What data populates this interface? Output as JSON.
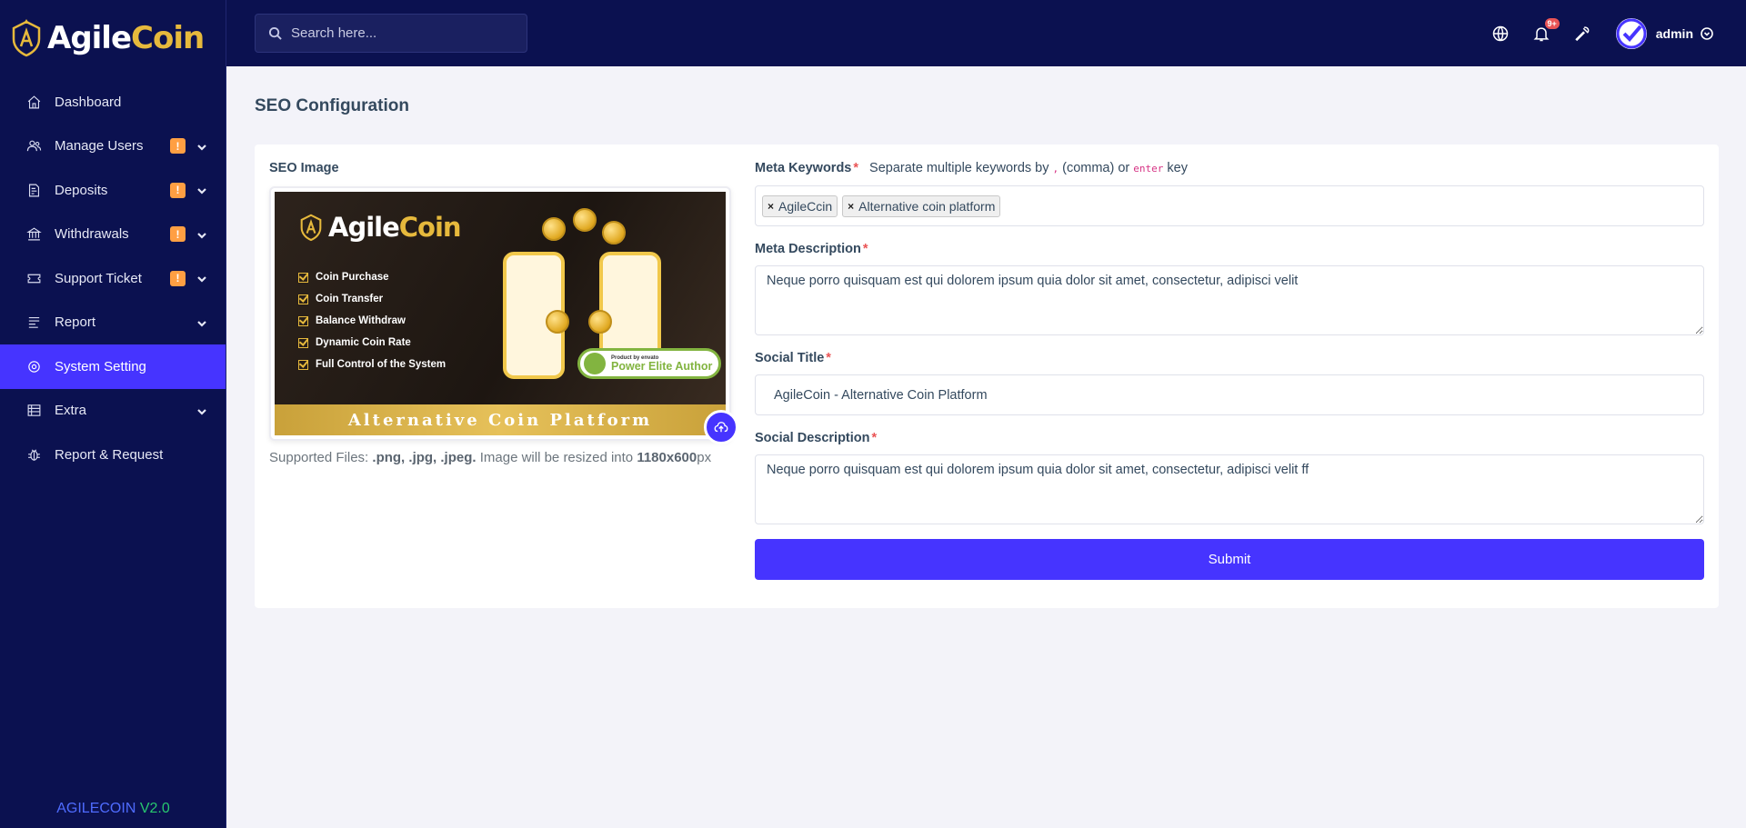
{
  "brand": {
    "name_part1": "Agile",
    "name_part2": "Coin"
  },
  "sidebar": {
    "items": [
      {
        "label": "Dashboard",
        "badge": "",
        "icon": "home-icon"
      },
      {
        "label": "Manage Users",
        "badge": "!",
        "icon": "users-icon"
      },
      {
        "label": "Deposits",
        "badge": "!",
        "icon": "deposit-icon"
      },
      {
        "label": "Withdrawals",
        "badge": "!",
        "icon": "bank-icon"
      },
      {
        "label": "Support Ticket",
        "badge": "!",
        "icon": "ticket-icon"
      },
      {
        "label": "Report",
        "badge": "",
        "icon": "list-icon"
      },
      {
        "label": "System Setting",
        "badge": "",
        "icon": "settings-icon"
      },
      {
        "label": "Extra",
        "badge": "",
        "icon": "server-icon"
      },
      {
        "label": "Report & Request",
        "badge": "",
        "icon": "bug-icon"
      }
    ],
    "version_name": "AGILECOIN",
    "version_number": "V2.0"
  },
  "topbar": {
    "search_placeholder": "Search here...",
    "notification_count": "9+",
    "username": "admin"
  },
  "page": {
    "title": "SEO Configuration",
    "seo_image_label": "SEO Image",
    "banner": {
      "title_part1": "Agile",
      "title_part2": "Coin",
      "features": [
        "Coin Purchase",
        "Coin Transfer",
        "Balance Withdraw",
        "Dynamic Coin Rate",
        "Full Control of the System"
      ],
      "badge_small": "Product by envato",
      "badge_big": "Power Elite Author",
      "strip_text": "Alternative Coin Platform"
    },
    "supported_prefix": "Supported Files:",
    "supported_types": ".png, .jpg, .jpeg.",
    "supported_mid": "Image will be resized into",
    "supported_size": "1180x600",
    "supported_unit": "px",
    "meta_keywords_label": "Meta Keywords",
    "meta_keywords_hint_1": "Separate multiple keywords by",
    "meta_keywords_hint_code1": ",",
    "meta_keywords_hint_2": "(comma) or",
    "meta_keywords_hint_code2": "enter",
    "meta_keywords_hint_3": "key",
    "keywords": [
      "AgileCcin",
      "Alternative coin platform"
    ],
    "meta_description_label": "Meta Description",
    "meta_description_value": "Neque porro quisquam est qui dolorem ipsum quia dolor sit amet, consectetur, adipisci velit",
    "social_title_label": "Social Title",
    "social_title_value": "AgileCoin - Alternative Coin Platform",
    "social_description_label": "Social Description",
    "social_description_value": "Neque porro quisquam est qui dolorem ipsum quia dolor sit amet, consectetur, adipisci velit ff",
    "submit_label": "Submit",
    "required_mark": "*"
  },
  "colors": {
    "sidebar_bg": "#0b1150",
    "accent": "#4634ff",
    "badge": "#ff9f43",
    "gold": "#e6b93c"
  }
}
